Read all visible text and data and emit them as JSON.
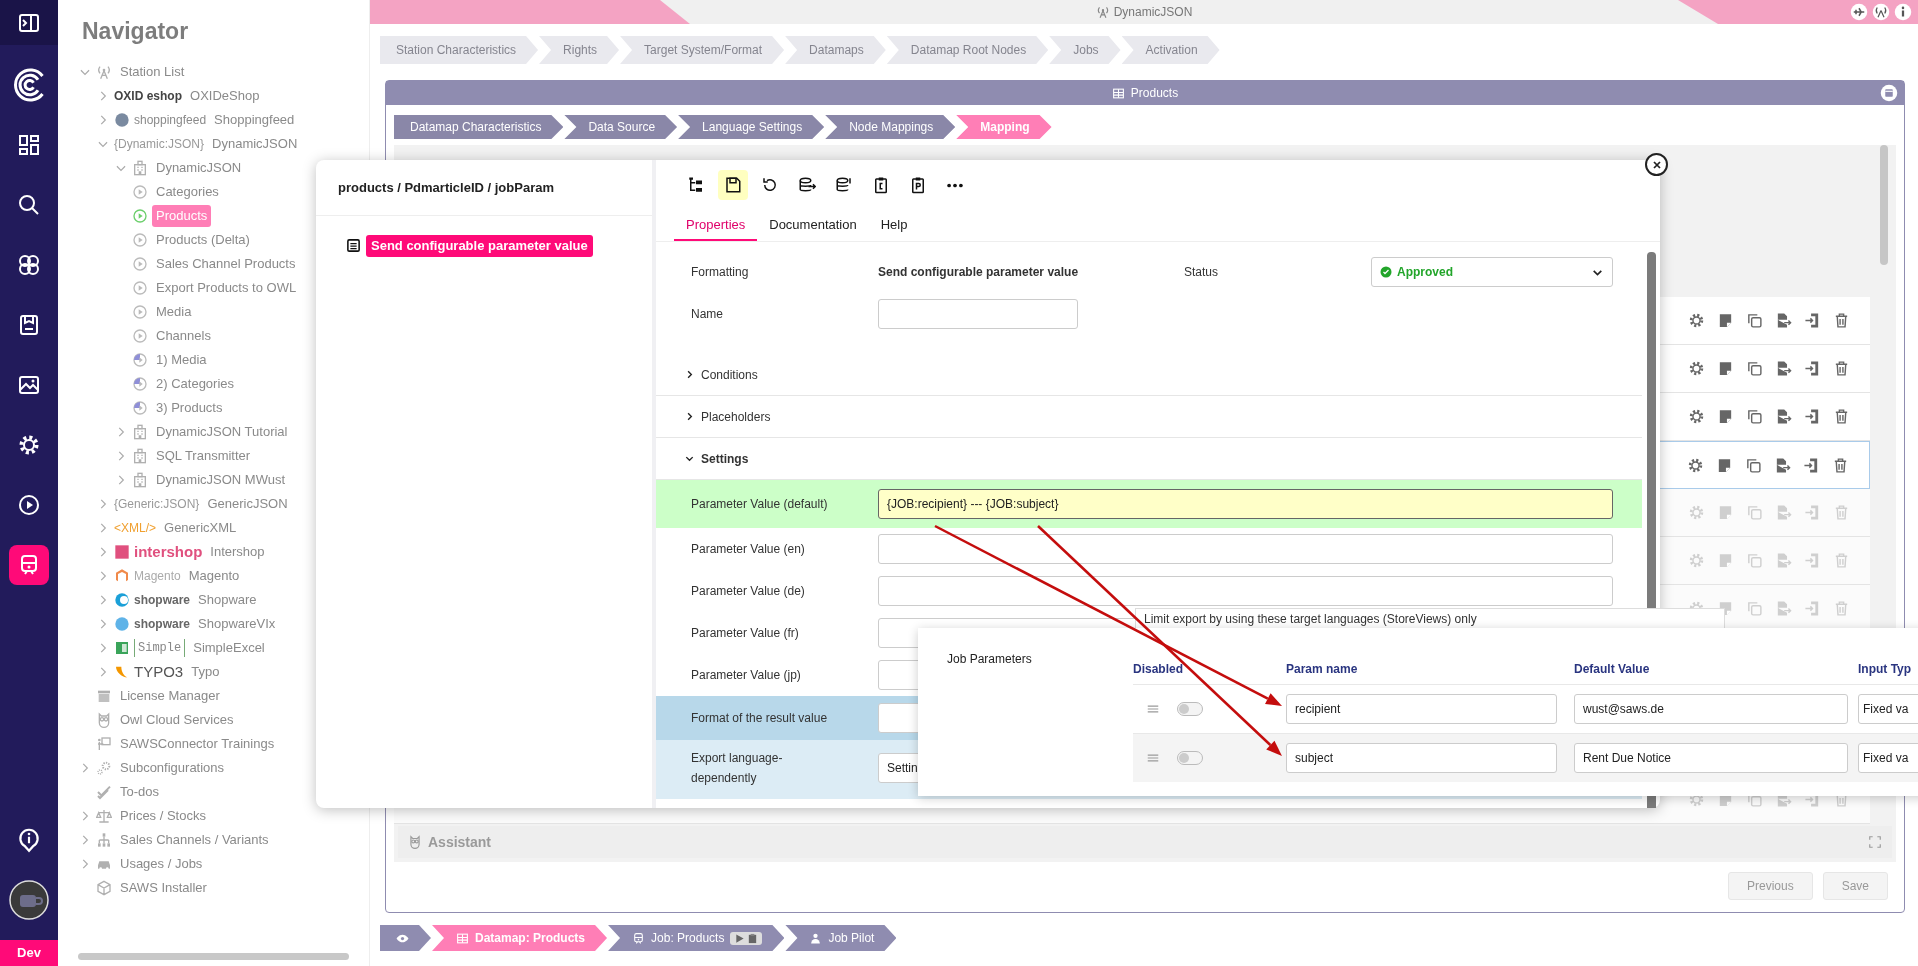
{
  "rail": {
    "items": [
      {
        "selected": false
      },
      {
        "selected": false
      },
      {
        "selected": false
      },
      {
        "selected": false
      },
      {
        "selected": false
      },
      {
        "selected": false
      },
      {
        "selected": false
      },
      {
        "selected": false
      },
      {
        "selected": false
      },
      {
        "selected": true
      }
    ],
    "env_badge": "Dev"
  },
  "navigator": {
    "title": "Navigator",
    "tree": [
      {
        "label": "Station List",
        "kind": "antenna",
        "expanded": true,
        "selected": false,
        "children": [
          {
            "label": "OXIDeShop",
            "kind": "oxid",
            "logo": "OXID eshop",
            "expanded": false,
            "selected": false
          },
          {
            "label": "Shoppingfeed",
            "kind": "shoppingfeed",
            "logo": "shoppingfeed",
            "expanded": false,
            "selected": false
          },
          {
            "label": "DynamicJSON",
            "kind": "dynamicjson",
            "logo": "{Dynamic:JSON}",
            "expanded": true,
            "selected": false,
            "children": [
              {
                "label": "DynamicJSON",
                "kind": "building",
                "expanded": true,
                "selected": false,
                "children": [
                  {
                    "label": "Categories",
                    "kind": "job",
                    "selected": false
                  },
                  {
                    "label": "Products",
                    "kind": "job",
                    "selected": true
                  },
                  {
                    "label": "Products (Delta)",
                    "kind": "job",
                    "selected": false
                  },
                  {
                    "label": "Sales Channel Products",
                    "kind": "job",
                    "selected": false
                  },
                  {
                    "label": "Export Products to OWL",
                    "kind": "job",
                    "selected": false
                  },
                  {
                    "label": "Media",
                    "kind": "job",
                    "selected": false
                  },
                  {
                    "label": "Channels",
                    "kind": "job",
                    "selected": false
                  },
                  {
                    "label": "1) Media",
                    "kind": "loop",
                    "selected": false
                  },
                  {
                    "label": "2) Categories",
                    "kind": "loop",
                    "selected": false
                  },
                  {
                    "label": "3) Products",
                    "kind": "loop",
                    "selected": false
                  }
                ]
              },
              {
                "label": "DynamicJSON Tutorial",
                "kind": "building",
                "expanded": false,
                "selected": false
              },
              {
                "label": "SQL Transmitter",
                "kind": "building",
                "expanded": false,
                "selected": false
              },
              {
                "label": "DynamicJSON MWust",
                "kind": "building",
                "expanded": false,
                "selected": false
              }
            ]
          },
          {
            "label": "GenericJSON",
            "kind": "genericjson",
            "logo": "{Generic:JSON}",
            "expanded": false,
            "selected": false
          },
          {
            "label": "GenericXML",
            "kind": "xml",
            "logo": "<XML/>",
            "expanded": false,
            "selected": false
          },
          {
            "label": "Intershop",
            "kind": "intershop",
            "logo": "intershop",
            "expanded": false,
            "selected": false
          },
          {
            "label": "Magento",
            "kind": "magento",
            "logo": "Magento",
            "expanded": false,
            "selected": false
          },
          {
            "label": "Shopware",
            "kind": "shopware",
            "logo": "shopware",
            "expanded": false,
            "selected": false
          },
          {
            "label": "ShopwareVIx",
            "kind": "shopware6",
            "logo": "shopware",
            "expanded": false,
            "selected": false
          },
          {
            "label": "SimpleExcel",
            "kind": "simple",
            "logo": "Simple",
            "expanded": false,
            "selected": false
          },
          {
            "label": "Typo",
            "kind": "typo3",
            "logo": "TYPO3",
            "expanded": false,
            "selected": false
          }
        ]
      },
      {
        "label": "License Manager",
        "kind": "license",
        "selected": false
      },
      {
        "label": "Owl Cloud Services",
        "kind": "owl",
        "selected": false
      },
      {
        "label": "SAWSConnector Trainings",
        "kind": "training",
        "selected": false
      },
      {
        "label": "Subconfigurations",
        "kind": "gears",
        "expanded": false,
        "selected": false
      },
      {
        "label": "To-dos",
        "kind": "todo",
        "selected": false
      },
      {
        "label": "Prices / Stocks",
        "kind": "scale",
        "expanded": false,
        "selected": false
      },
      {
        "label": "Sales Channels / Variants",
        "kind": "hierarchy",
        "expanded": false,
        "selected": false
      },
      {
        "label": "Usages / Jobs",
        "kind": "car",
        "expanded": false,
        "selected": false
      },
      {
        "label": "SAWS Installer",
        "kind": "box",
        "selected": false
      }
    ]
  },
  "header": {
    "title": "DynamicJSON"
  },
  "steps": [
    {
      "label": "Station Characteristics",
      "selected": false
    },
    {
      "label": "Rights",
      "selected": false
    },
    {
      "label": "Target System/Format",
      "selected": false
    },
    {
      "label": "Datamaps",
      "selected": false
    },
    {
      "label": "Datamap Root Nodes",
      "selected": false
    },
    {
      "label": "Jobs",
      "selected": false
    },
    {
      "label": "Activation",
      "selected": false
    }
  ],
  "panel": {
    "title": "Products",
    "tabs": [
      {
        "label": "Datamap Characteristics",
        "selected": false
      },
      {
        "label": "Data Source",
        "selected": false
      },
      {
        "label": "Language Settings",
        "selected": false
      },
      {
        "label": "Node Mappings",
        "selected": false
      },
      {
        "label": "Mapping",
        "selected": true
      }
    ],
    "rows": [
      {
        "selected": false,
        "disabled": false
      },
      {
        "selected": false,
        "disabled": false
      },
      {
        "selected": false,
        "disabled": false
      },
      {
        "selected": true,
        "disabled": false
      },
      {
        "selected": false,
        "disabled": true
      },
      {
        "selected": false,
        "disabled": true
      },
      {
        "selected": false,
        "disabled": true
      },
      {
        "selected": false,
        "disabled": true
      }
    ],
    "assistant": "Assistant",
    "buttons": [
      "Previous",
      "Save"
    ]
  },
  "dialog": {
    "path": "products / PdmarticleID / jobParam",
    "node": {
      "label": "Send configurable parameter value",
      "selected": true
    },
    "toolbar": [
      {
        "active": false
      },
      {
        "active": true
      },
      {
        "active": false
      },
      {
        "active": false
      },
      {
        "active": false
      },
      {
        "active": false
      },
      {
        "active": false
      },
      {
        "active": false
      }
    ],
    "tabs": [
      {
        "label": "Properties",
        "selected": true
      },
      {
        "label": "Documentation",
        "selected": false
      },
      {
        "label": "Help",
        "selected": false
      }
    ],
    "formatting_label": "Formatting",
    "formatting_value": "Send configurable parameter value",
    "status_label": "Status",
    "status_value": "Approved",
    "name_label": "Name",
    "sections": [
      {
        "label": "Conditions",
        "expanded": false
      },
      {
        "label": "Placeholders",
        "expanded": false
      },
      {
        "label": "Settings",
        "expanded": true
      }
    ],
    "fields": [
      {
        "label": "Parameter Value (default)",
        "value": "{JOB:recipient} --- {JOB:subject}",
        "kind": "highlight"
      },
      {
        "label": "Parameter Value (en)",
        "kind": "plain"
      },
      {
        "label": "Parameter Value (de)",
        "kind": "plain"
      },
      {
        "label": "Parameter Value (fr)",
        "kind": "plain"
      },
      {
        "label": "Parameter Value (jp)",
        "kind": "plain"
      },
      {
        "label": "Format of the result value",
        "kind": "result"
      },
      {
        "label": "Export language-dependently",
        "value": "Settin",
        "kind": "language"
      }
    ]
  },
  "behind_field": {
    "value": "Limit export by using these target languages (StoreViews) only"
  },
  "job_parameters": {
    "title": "Job Parameters",
    "columns": [
      "Disabled",
      "Param name",
      "Default Value",
      "Input Typ"
    ],
    "rows": [
      {
        "disabled": false,
        "param": "recipient",
        "default": "wust@saws.de",
        "input_type": "Fixed va"
      },
      {
        "disabled": false,
        "param": "subject",
        "default": "Rent Due Notice",
        "input_type": "Fixed va"
      }
    ]
  },
  "footer": [
    {
      "kind": "view",
      "selected": false
    },
    {
      "kind": "datamap",
      "label": "Datamap: Products",
      "selected": true
    },
    {
      "kind": "job",
      "label": "Job: Products",
      "selected": false
    },
    {
      "kind": "pilot",
      "label": "Job Pilot",
      "selected": false
    }
  ]
}
